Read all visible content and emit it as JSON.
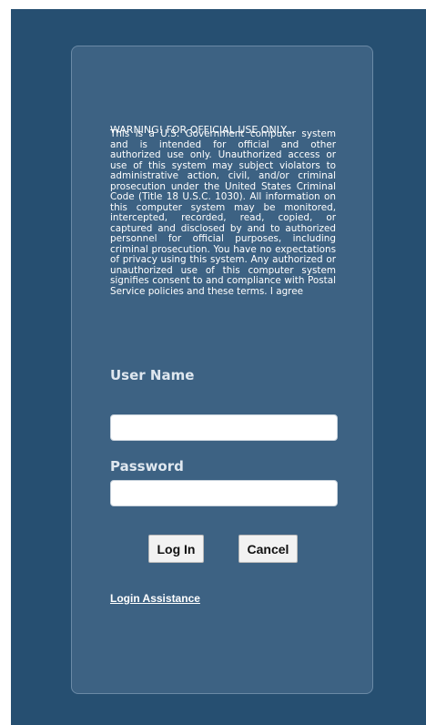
{
  "warning": {
    "title": "WARNING! FOR OFFICIAL USE ONLY...",
    "body": "This is a U.S. Government computer system and is intended for official and other authorized use only. Unauthorized access or use of this system may subject violators to administrative action, civil, and/or criminal prosecution under the United States Criminal Code (Title 18 U.S.C. 1030). All information on this computer system may be monitored, intercepted, recorded, read, copied, or captured and disclosed by and to authorized personnel for official purposes, including criminal prosecution. You have no expectations of privacy using this system. Any authorized or unauthorized use of this computer system signifies consent to and compliance with Postal Service policies and these terms. I agree"
  },
  "form": {
    "username_label": "User Name",
    "username_value": "",
    "password_label": "Password",
    "password_value": "",
    "login_label": "Log In",
    "cancel_label": "Cancel",
    "assistance_label": "Login Assistance"
  },
  "colors": {
    "page_background": "#264f71",
    "panel_background": "#3d6283",
    "panel_border": "#6b8aa6",
    "text": "#ffffff",
    "label_text": "#dfe7ef",
    "button_background": "#f2f2f2"
  }
}
